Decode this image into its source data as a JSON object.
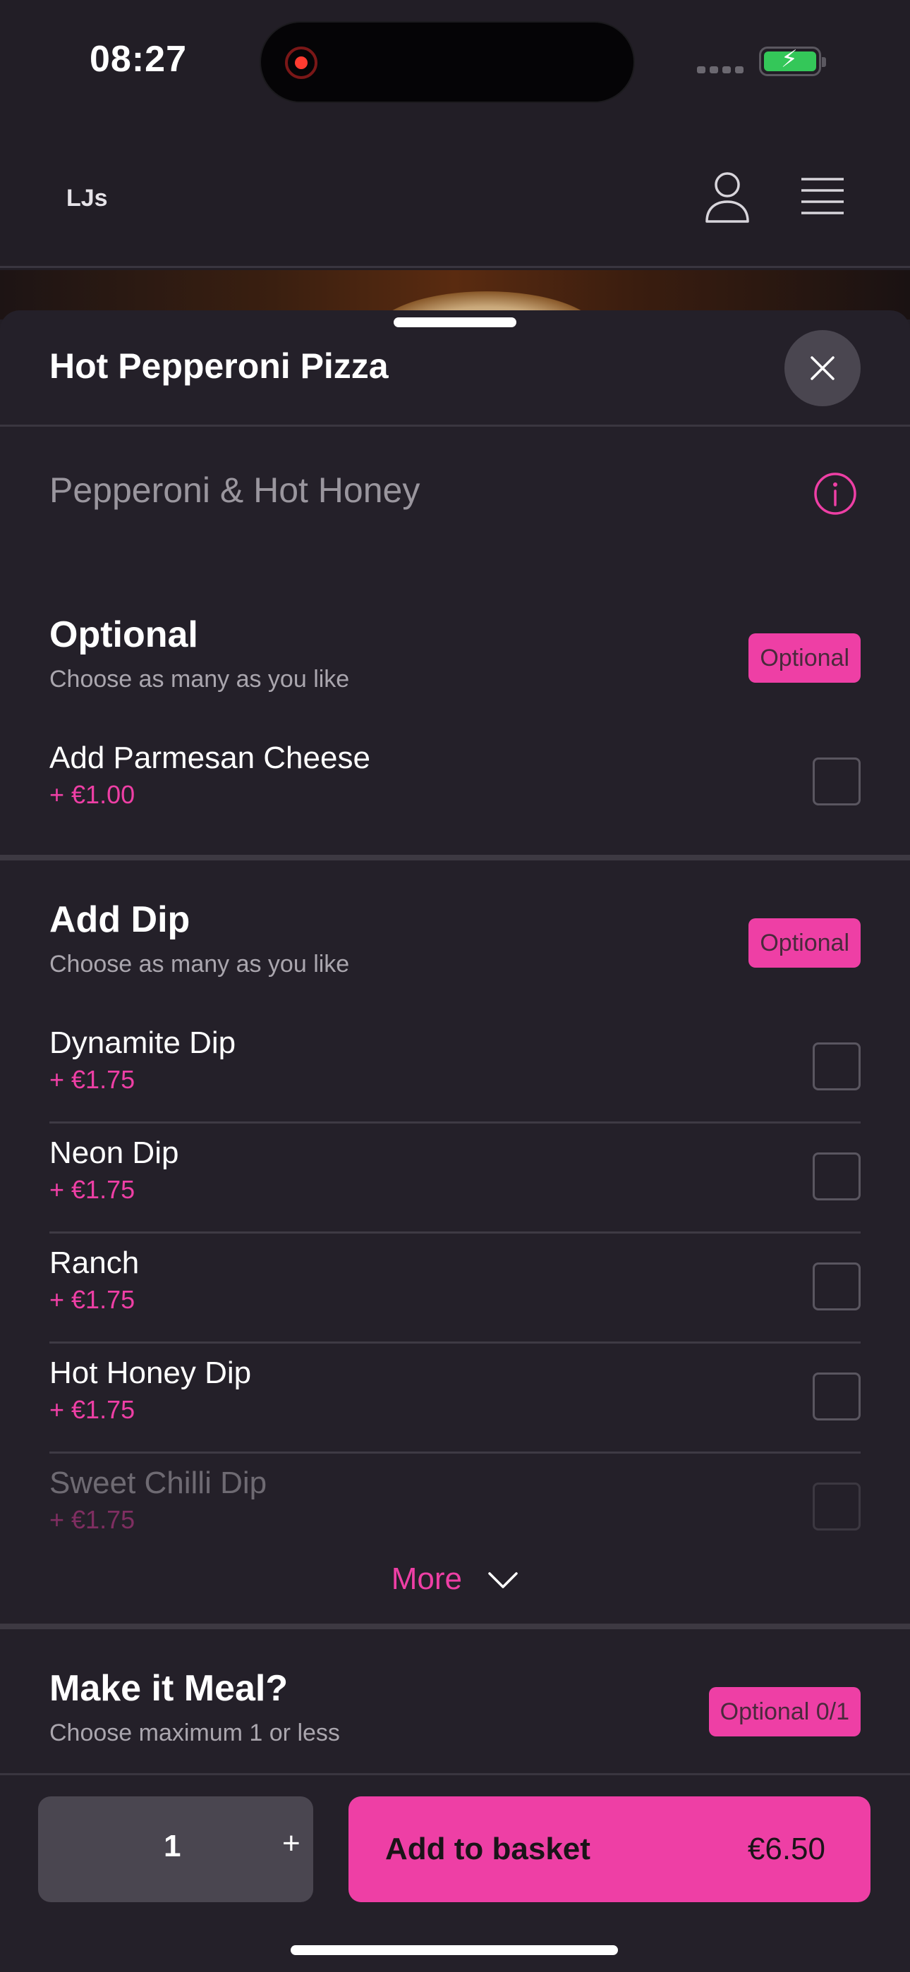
{
  "status_bar": {
    "time": "08:27"
  },
  "header": {
    "brand": "LJs"
  },
  "item": {
    "title": "Hot Pepperoni Pizza",
    "description": "Pepperoni & Hot Honey"
  },
  "sections": [
    {
      "title": "Optional",
      "subtitle": "Choose as many as you like",
      "badge": "Optional",
      "options": [
        {
          "name": "Add Parmesan Cheese",
          "price": "+ €1.00",
          "checked": false
        }
      ]
    },
    {
      "title": "Add Dip",
      "subtitle": "Choose as many as you like",
      "badge": "Optional",
      "options": [
        {
          "name": "Dynamite Dip",
          "price": "+ €1.75",
          "checked": false
        },
        {
          "name": "Neon Dip",
          "price": "+ €1.75",
          "checked": false
        },
        {
          "name": "Ranch",
          "price": "+ €1.75",
          "checked": false
        },
        {
          "name": "Hot Honey Dip",
          "price": "+ €1.75",
          "checked": false
        },
        {
          "name": "Sweet Chilli Dip",
          "price": "+ €1.75",
          "checked": false
        }
      ],
      "more_label": "More"
    },
    {
      "title": "Make it Meal?",
      "subtitle": "Choose maximum 1 or less",
      "badge": "Optional 0/1"
    }
  ],
  "footer": {
    "quantity": "1",
    "plus": "+",
    "add_label": "Add to basket",
    "total": "€6.50"
  },
  "colors": {
    "accent": "#ee3fa5",
    "background": "#242029",
    "text_muted": "#aaa6ae"
  },
  "icons": [
    "user-icon",
    "menu-icon",
    "close-icon",
    "info-icon",
    "chevron-down-icon"
  ]
}
